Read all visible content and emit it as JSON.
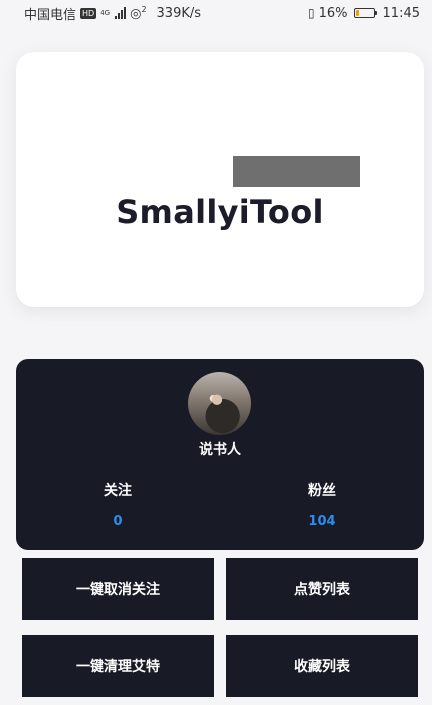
{
  "status_bar": {
    "carrier": "中国电信",
    "hd": "HD",
    "network_gen": "4G",
    "wifi_sup": "2",
    "speed": "339K/s",
    "battery_percent": "16%",
    "battery_level": 0.16,
    "time": "11:45"
  },
  "banner": {
    "title": "SmallyiTool"
  },
  "profile": {
    "username": "说书人",
    "follow_label": "关注",
    "follow_count": "0",
    "fans_label": "粉丝",
    "fans_count": "104"
  },
  "actions": {
    "unfollow_all": "一键取消关注",
    "like_list": "点赞列表",
    "clear_mentions": "一键清理艾特",
    "favorites_list": "收藏列表"
  },
  "colors": {
    "card_dark": "#181b26",
    "accent_blue": "#2a8df0"
  }
}
